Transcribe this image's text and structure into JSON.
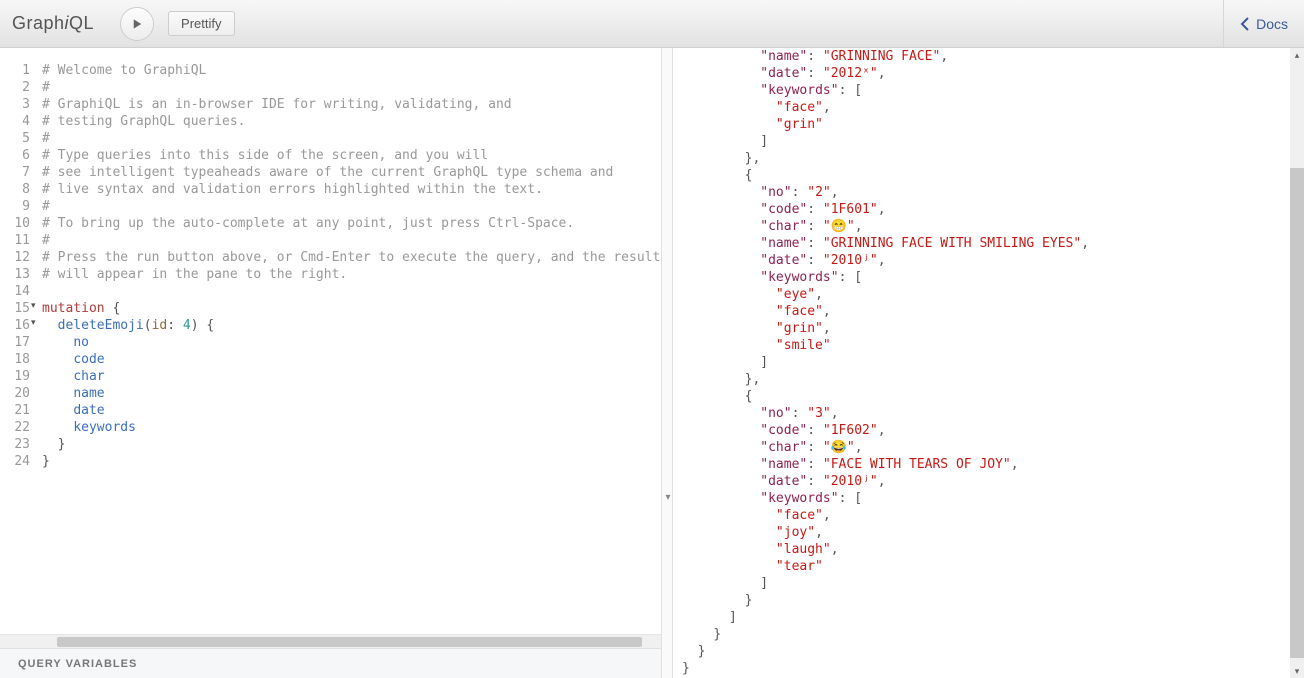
{
  "header": {
    "title_pre": "Graph",
    "title_i": "i",
    "title_post": "QL",
    "prettify_label": "Prettify",
    "docs_label": "Docs"
  },
  "editor": {
    "lines": [
      {
        "n": "1",
        "t": "comment",
        "text": "# Welcome to GraphiQL"
      },
      {
        "n": "2",
        "t": "comment",
        "text": "#"
      },
      {
        "n": "3",
        "t": "comment",
        "text": "# GraphiQL is an in-browser IDE for writing, validating, and"
      },
      {
        "n": "4",
        "t": "comment",
        "text": "# testing GraphQL queries."
      },
      {
        "n": "5",
        "t": "comment",
        "text": "#"
      },
      {
        "n": "6",
        "t": "comment",
        "text": "# Type queries into this side of the screen, and you will"
      },
      {
        "n": "7",
        "t": "comment",
        "text": "# see intelligent typeaheads aware of the current GraphQL type schema and"
      },
      {
        "n": "8",
        "t": "comment",
        "text": "# live syntax and validation errors highlighted within the text."
      },
      {
        "n": "9",
        "t": "comment",
        "text": "#"
      },
      {
        "n": "10",
        "t": "comment",
        "text": "# To bring up the auto-complete at any point, just press Ctrl-Space."
      },
      {
        "n": "11",
        "t": "comment",
        "text": "#"
      },
      {
        "n": "12",
        "t": "comment",
        "text": "# Press the run button above, or Cmd-Enter to execute the query, and the result"
      },
      {
        "n": "13",
        "t": "comment",
        "text": "# will appear in the pane to the right."
      },
      {
        "n": "14",
        "t": "blank",
        "text": ""
      },
      {
        "n": "15",
        "t": "mutation_open"
      },
      {
        "n": "16",
        "t": "delete_call"
      },
      {
        "n": "17",
        "t": "field",
        "text": "no"
      },
      {
        "n": "18",
        "t": "field",
        "text": "code"
      },
      {
        "n": "19",
        "t": "field",
        "text": "char"
      },
      {
        "n": "20",
        "t": "field",
        "text": "name"
      },
      {
        "n": "21",
        "t": "field",
        "text": "date"
      },
      {
        "n": "22",
        "t": "field",
        "text": "keywords"
      },
      {
        "n": "23",
        "t": "close1",
        "text": "  }"
      },
      {
        "n": "24",
        "t": "close2",
        "text": "}"
      }
    ],
    "mutation_kw": "mutation",
    "delete_fn": "deleteEmoji",
    "delete_arg": "id",
    "delete_argval": "4",
    "query_variables_label": "QUERY VARIABLES"
  },
  "result": {
    "items": [
      {
        "fragment_top": true,
        "name_key": "name",
        "name_val": "GRINNING FACE",
        "date_key": "date",
        "date_val": "2012ˣ",
        "kw_key": "keywords",
        "kw": [
          "face",
          "grin"
        ]
      },
      {
        "no_key": "no",
        "no_val": "2",
        "code_key": "code",
        "code_val": "1F601",
        "char_key": "char",
        "char_val": "😁",
        "name_key": "name",
        "name_val": "GRINNING FACE WITH SMILING EYES",
        "date_key": "date",
        "date_val": "2010ʲ",
        "kw_key": "keywords",
        "kw": [
          "eye",
          "face",
          "grin",
          "smile"
        ]
      },
      {
        "no_key": "no",
        "no_val": "3",
        "code_key": "code",
        "code_val": "1F602",
        "char_key": "char",
        "char_val": "😂",
        "name_key": "name",
        "name_val": "FACE WITH TEARS OF JOY",
        "date_key": "date",
        "date_val": "2010ʲ",
        "kw_key": "keywords",
        "kw": [
          "face",
          "joy",
          "laugh",
          "tear"
        ]
      }
    ]
  }
}
